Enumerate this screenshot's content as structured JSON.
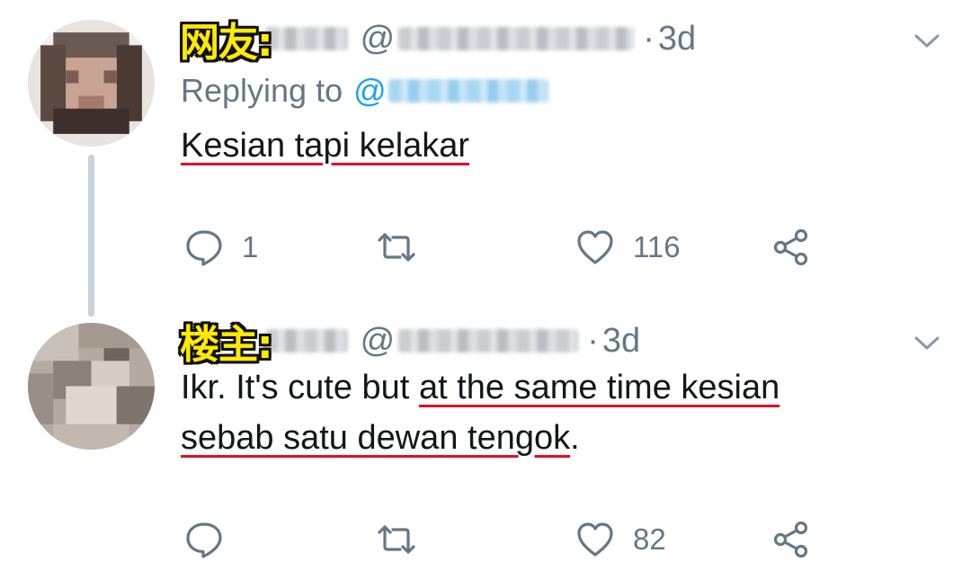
{
  "thread": {
    "tweets": [
      {
        "tag": "网友:",
        "at": "@",
        "time_sep": "·",
        "time": "3d",
        "replying_label": "Replying to",
        "replying_at": "@",
        "text_underlined": "Kesian tapi kelakar",
        "text_plain_after": "",
        "actions": {
          "reply_count": "1",
          "retweet_count": "",
          "like_count": "116"
        }
      },
      {
        "tag": "楼主:",
        "at": "@",
        "time_sep": "·",
        "time": "3d",
        "text_line1_plain": "Ikr. It's cute but ",
        "text_line1_underlined": "at the same time kesian",
        "text_line2_underlined": "sebab satu dewan tengok",
        "text_line2_plain": ".",
        "actions": {
          "reply_count": "",
          "retweet_count": "",
          "like_count": "82"
        }
      }
    ]
  },
  "icons": {
    "reply": "comment-bubble-icon",
    "retweet": "retweet-icon",
    "like": "heart-icon",
    "share": "share-icon",
    "menu": "chevron-down-icon"
  },
  "colors": {
    "muted_text": "#657786",
    "mention_blue": "#1da1f2",
    "underline_red": "#e0102a",
    "tag_yellow": "#ffeb00",
    "thread_line": "#c9d3db"
  }
}
